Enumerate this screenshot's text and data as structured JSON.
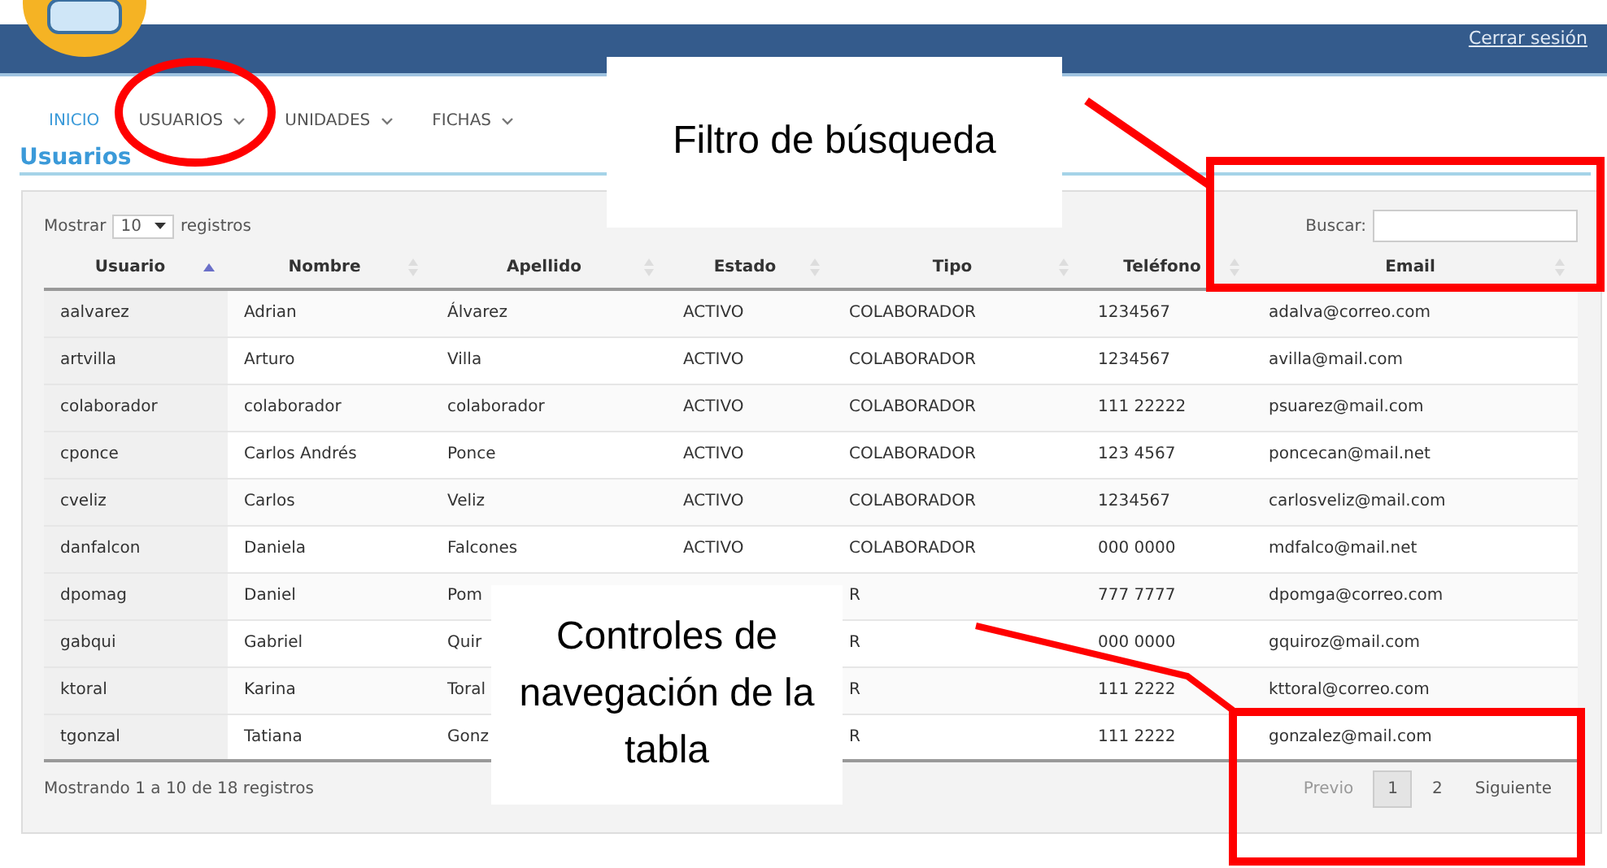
{
  "header": {
    "logout_link": "Cerrar sesión"
  },
  "nav": [
    {
      "label": "INICIO",
      "selected": true,
      "has_menu": false
    },
    {
      "label": "USUARIOS",
      "selected": false,
      "has_menu": true
    },
    {
      "label": "UNIDADES",
      "selected": false,
      "has_menu": true
    },
    {
      "label": "FICHAS",
      "selected": false,
      "has_menu": true
    }
  ],
  "page_title": "Usuarios",
  "table_controls": {
    "show_label": "Mostrar",
    "page_size": "10",
    "records_label": "registros",
    "search_label": "Buscar:"
  },
  "table": {
    "columns": [
      {
        "label": "Usuario",
        "sorted": true
      },
      {
        "label": "Nombre",
        "sorted": false
      },
      {
        "label": "Apellido",
        "sorted": false
      },
      {
        "label": "Estado",
        "sorted": false
      },
      {
        "label": "Tipo",
        "sorted": false
      },
      {
        "label": "Teléfono",
        "sorted": false
      },
      {
        "label": "Email",
        "sorted": false
      }
    ],
    "rows": [
      [
        "aalvarez",
        "Adrian",
        "Álvarez",
        "ACTIVO",
        "COLABORADOR",
        "1234567",
        "adalva@correo.com"
      ],
      [
        "artvilla",
        "Arturo",
        "Villa",
        "ACTIVO",
        "COLABORADOR",
        "1234567",
        "avilla@mail.com"
      ],
      [
        "colaborador",
        "colaborador",
        "colaborador",
        "ACTIVO",
        "COLABORADOR",
        "111 22222",
        "psuarez@mail.com"
      ],
      [
        "cponce",
        "Carlos Andrés",
        "Ponce",
        "ACTIVO",
        "COLABORADOR",
        "123 4567",
        "poncecan@mail.net"
      ],
      [
        "cveliz",
        "Carlos",
        "Veliz",
        "ACTIVO",
        "COLABORADOR",
        "1234567",
        "carlosveliz@mail.com"
      ],
      [
        "danfalcon",
        "Daniela",
        "Falcones",
        "ACTIVO",
        "COLABORADOR",
        "000 0000",
        "mdfalco@mail.net"
      ],
      [
        "dpomag",
        "Daniel",
        "Pom",
        null,
        "R",
        "777 7777",
        "dpomga@correo.com"
      ],
      [
        "gabqui",
        "Gabriel",
        "Quir",
        null,
        "R",
        "000 0000",
        "gquiroz@mail.com"
      ],
      [
        "ktoral",
        "Karina",
        "Toral",
        null,
        "R",
        "111 2222",
        "kttoral@correo.com"
      ],
      [
        "tgonzal",
        "Tatiana",
        "Gonz",
        null,
        "R",
        "111 2222",
        "gonzalez@mail.com"
      ]
    ]
  },
  "footer": {
    "info": "Mostrando 1 a 10 de 18 registros",
    "previous": "Previo",
    "pages": [
      {
        "label": "1",
        "selected": true
      },
      {
        "label": "2",
        "selected": false
      }
    ],
    "next": "Siguiente"
  },
  "annotations": [
    {
      "kind": "callout",
      "text": "Filtro de búsqueda"
    },
    {
      "kind": "callout",
      "text": "Controles de navegación de la tabla"
    }
  ]
}
